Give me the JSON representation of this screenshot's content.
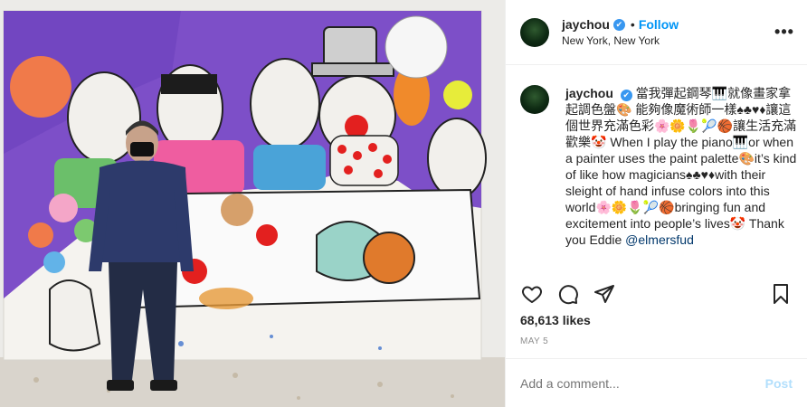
{
  "photo": {
    "alt": "Artist standing in front of a large colorful painting"
  },
  "header": {
    "username": "jaychou",
    "verified_badge": "✔",
    "separator": "•",
    "follow_label": "Follow",
    "location": "New York, New York",
    "more_icon": "•••"
  },
  "caption": {
    "username": "jaychou",
    "verified_badge": "✔",
    "text": " 當我彈起鋼琴🎹就像畫家拿起調色盤🎨 能夠像魔術師一樣♠♣♥♦讓這個世界充滿色彩🌸🌼🌷🎾🏀讓生活充滿歡樂🤡 When I play the piano🎹or when a painter uses the paint palette🎨it’s kind of like how magicians♠♣♥♦with their sleight of hand infuse colors into this world🌸🌼🌷🎾🏀bringing fun and excitement into people’s lives🤡 Thank you Eddie ",
    "mention": "@elmersfud"
  },
  "actions": {
    "like_icon": "heart-icon",
    "comment_icon": "comment-icon",
    "share_icon": "share-icon",
    "save_icon": "bookmark-icon"
  },
  "likes": "68,613 likes",
  "date": "MAY 5",
  "comment_box": {
    "placeholder": "Add a comment...",
    "post_label": "Post"
  },
  "colors": {
    "accent": "#0095f6",
    "verified": "#3897f0",
    "muted": "#8e8e8e"
  }
}
